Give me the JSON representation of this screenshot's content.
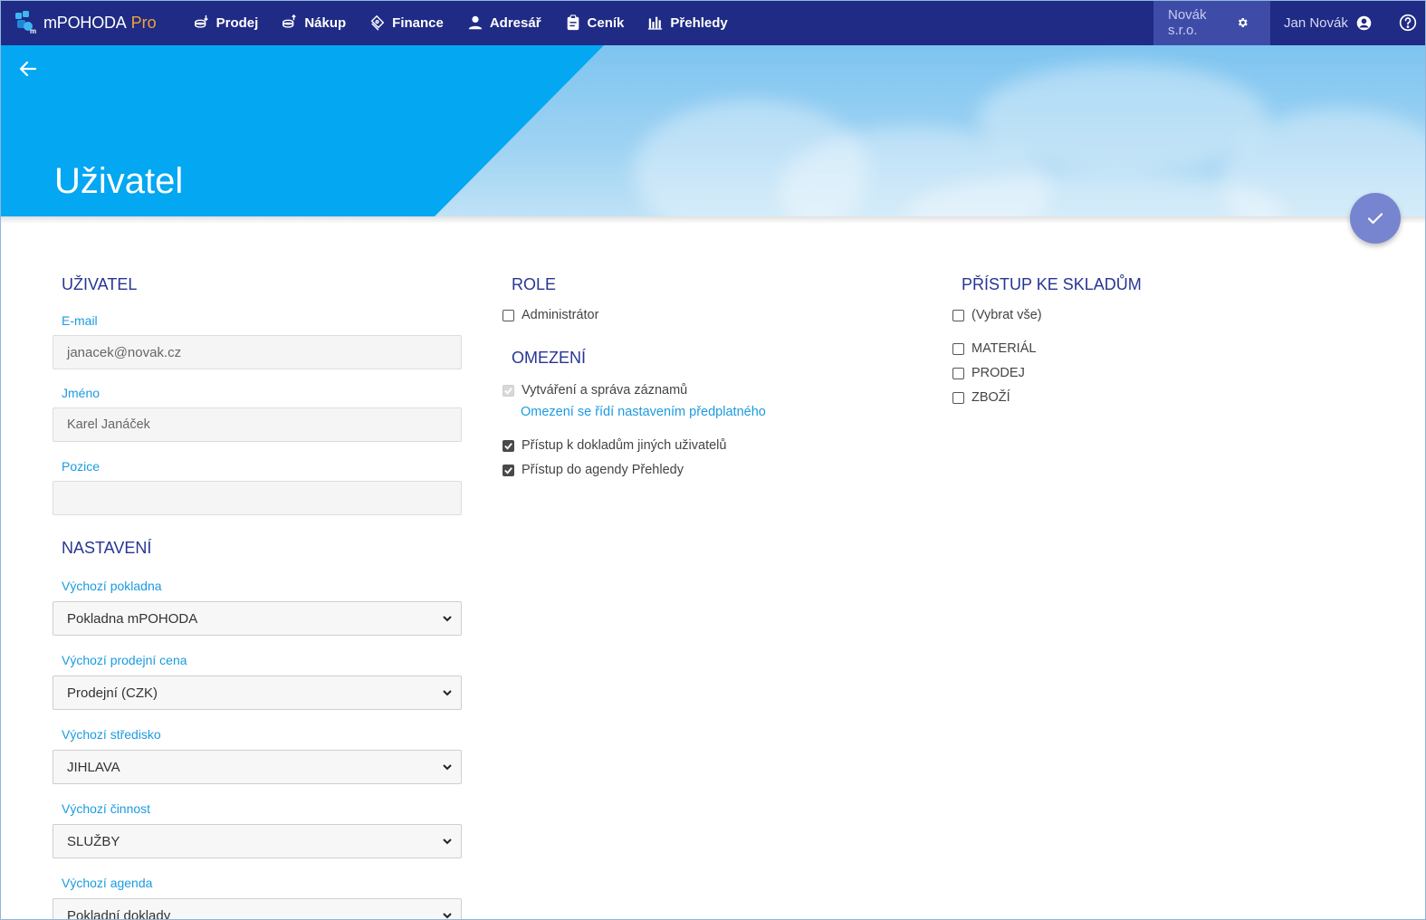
{
  "app": {
    "name": "mPOHODA",
    "edition": "Pro"
  },
  "nav": {
    "items": [
      {
        "label": "Prodej",
        "icon": "sales-icon"
      },
      {
        "label": "Nákup",
        "icon": "purchase-icon"
      },
      {
        "label": "Finance",
        "icon": "finance-icon"
      },
      {
        "label": "Adresář",
        "icon": "person-icon"
      },
      {
        "label": "Ceník",
        "icon": "clipboard-icon"
      },
      {
        "label": "Přehledy",
        "icon": "bar-chart-icon"
      }
    ]
  },
  "header": {
    "company": "Novák s.r.o.",
    "user": "Jan Novák"
  },
  "page": {
    "title": "Uživatel"
  },
  "user_section": {
    "title": "UŽIVATEL",
    "email_label": "E-mail",
    "email_value": "janacek@novak.cz",
    "name_label": "Jméno",
    "name_value": "Karel Janáček",
    "position_label": "Pozice",
    "position_value": ""
  },
  "settings_section": {
    "title": "NASTAVENÍ",
    "fields": [
      {
        "label": "Výchozí pokladna",
        "value": "Pokladna mPOHODA"
      },
      {
        "label": "Výchozí prodejní cena",
        "value": "Prodejní (CZK)"
      },
      {
        "label": "Výchozí středisko",
        "value": "JIHLAVA"
      },
      {
        "label": "Výchozí činnost",
        "value": "SLUŽBY"
      },
      {
        "label": "Výchozí agenda",
        "value": "Pokladní doklady"
      }
    ]
  },
  "role_section": {
    "title": "ROLE",
    "admin_label": "Administrátor",
    "admin_checked": false
  },
  "restrictions_section": {
    "title": "OMEZENÍ",
    "create_label": "Vytváření a správa záznamů",
    "create_checked": true,
    "create_disabled": true,
    "subscription_link": "Omezení se řídí nastavením předplatného",
    "others_docs_label": "Přístup k dokladům jiných uživatelů",
    "others_docs_checked": true,
    "reports_label": "Přístup do agendy Přehledy",
    "reports_checked": true
  },
  "warehouse_section": {
    "title": "PŘÍSTUP KE SKLADŮM",
    "select_all_label": "(Vybrat vše)",
    "items": [
      {
        "label": "MATERIÁL",
        "checked": false
      },
      {
        "label": "PRODEJ",
        "checked": false
      },
      {
        "label": "ZBOŽÍ",
        "checked": false
      }
    ]
  },
  "colors": {
    "topbar": "#1f2b85",
    "company_bg": "#3e4ca8",
    "banner_blue": "#03a7f2",
    "section_title": "#283593",
    "label_blue": "#1a9be0",
    "fab": "#7784cf",
    "logo_pro": "#f0a33a"
  }
}
